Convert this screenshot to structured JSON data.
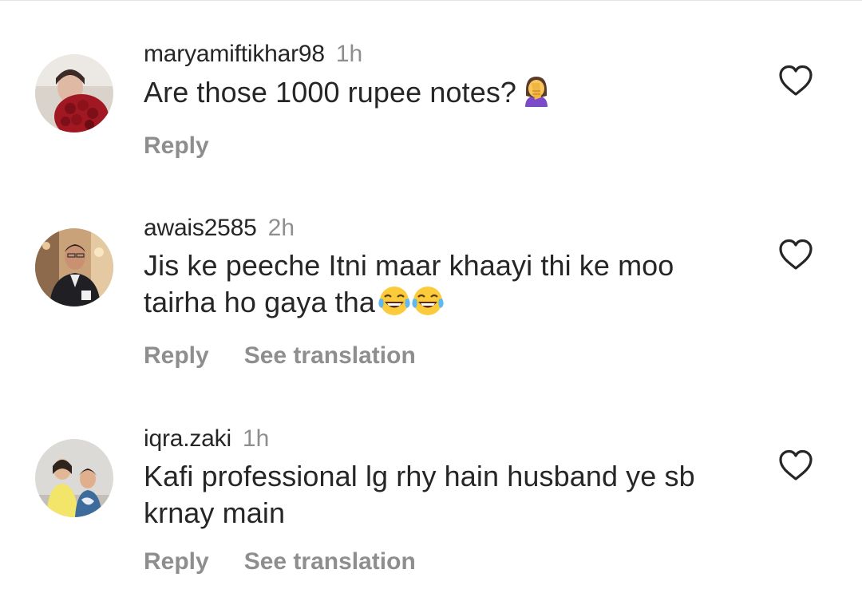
{
  "comments": [
    {
      "username": "maryamiftikhar98",
      "time": "1h",
      "text": "Are those 1000 rupee notes?",
      "emoji": "woman-facepalming",
      "reply_label": "Reply",
      "translation_label": ""
    },
    {
      "username": "awais2585",
      "time": "2h",
      "text": "Jis ke peeche Itni maar khaayi thi ke moo tairha ho gaya tha",
      "emoji": "face-with-tears-of-joy x2",
      "reply_label": "Reply",
      "translation_label": "See translation"
    },
    {
      "username": "iqra.zaki",
      "time": "1h",
      "text": "Kafi professional lg rhy hain husband ye sb krnay main",
      "emoji": "",
      "reply_label": "Reply",
      "translation_label": "See translation"
    }
  ],
  "icons": {
    "like": "heart-outline-icon"
  },
  "colors": {
    "text": "#262626",
    "secondary": "#8e8e8e",
    "background": "#ffffff"
  }
}
